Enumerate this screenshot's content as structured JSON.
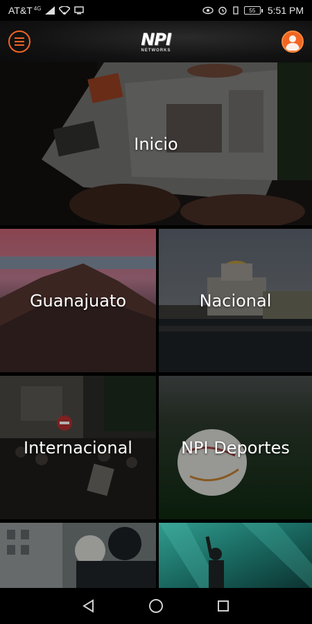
{
  "status_bar": {
    "carrier": "AT&T",
    "network": "4G",
    "battery": "55",
    "time": "5:51 PM"
  },
  "app_bar": {
    "logo_text": "NPI",
    "logo_subtext": "NETWORKS"
  },
  "tiles": {
    "inicio": "Inicio",
    "guanajuato": "Guanajuato",
    "nacional": "Nacional",
    "internacional": "Internacional",
    "deportes": "NPI Deportes"
  },
  "icons": {
    "menu": "menu-icon",
    "profile": "person-icon",
    "back": "back-triangle-icon",
    "home": "home-circle-icon",
    "recents": "recents-square-icon"
  },
  "colors": {
    "accent": "#f26522"
  }
}
